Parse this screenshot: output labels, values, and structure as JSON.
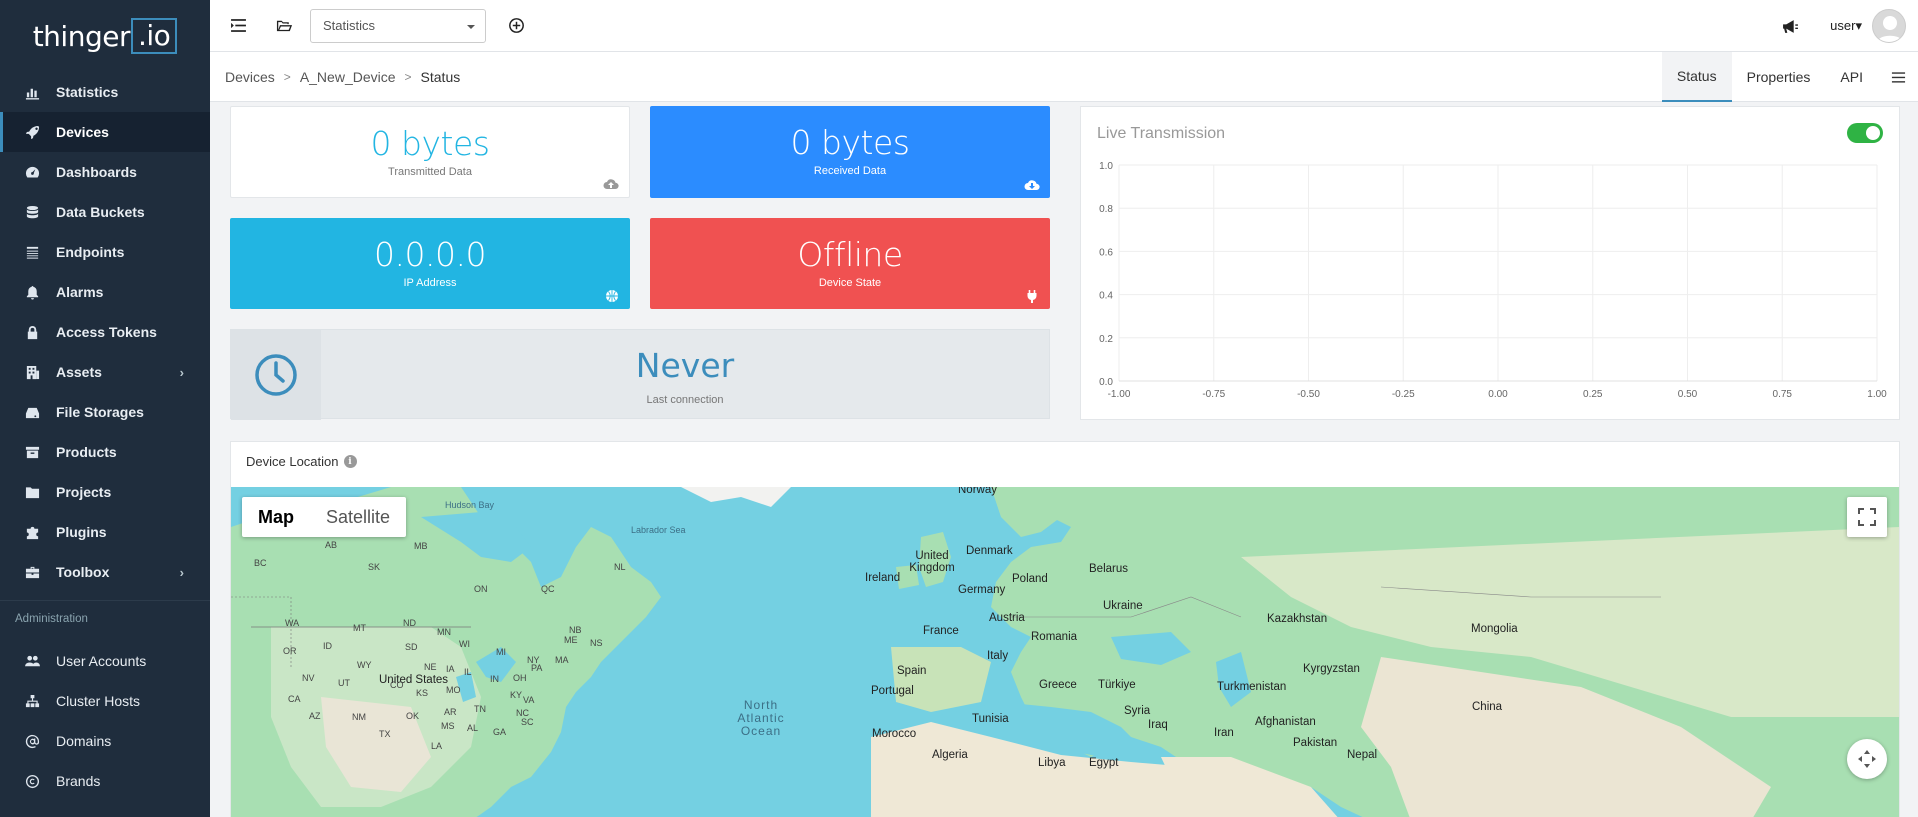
{
  "brand": {
    "name": "thinger",
    "suffix": ".io"
  },
  "sidebar": {
    "items": [
      {
        "label": "Statistics",
        "icon": "bar-chart-icon"
      },
      {
        "label": "Devices",
        "icon": "rocket-icon",
        "active": true
      },
      {
        "label": "Dashboards",
        "icon": "tachometer-icon"
      },
      {
        "label": "Data Buckets",
        "icon": "database-icon"
      },
      {
        "label": "Endpoints",
        "icon": "list-icon"
      },
      {
        "label": "Alarms",
        "icon": "bell-icon"
      },
      {
        "label": "Access Tokens",
        "icon": "lock-icon"
      },
      {
        "label": "Assets",
        "icon": "building-icon",
        "arrow": "›"
      },
      {
        "label": "File Storages",
        "icon": "hdd-icon"
      },
      {
        "label": "Products",
        "icon": "archive-icon"
      },
      {
        "label": "Projects",
        "icon": "folder-icon"
      },
      {
        "label": "Plugins",
        "icon": "puzzle-icon"
      },
      {
        "label": "Toolbox",
        "icon": "toolbox-icon",
        "arrow": "›"
      }
    ],
    "admin_header": "Administration",
    "admin_items": [
      {
        "label": "User Accounts",
        "icon": "users-icon"
      },
      {
        "label": "Cluster Hosts",
        "icon": "sitemap-icon"
      },
      {
        "label": "Domains",
        "icon": "at-icon"
      },
      {
        "label": "Brands",
        "icon": "copyright-icon"
      }
    ]
  },
  "topbar": {
    "select_value": "Statistics",
    "user_label": "user▾"
  },
  "breadcrumb": [
    "Devices",
    "A_New_Device",
    "Status"
  ],
  "tabs": [
    "Status",
    "Properties",
    "API"
  ],
  "stats": {
    "transmitted": {
      "value": "0 bytes",
      "label": "Transmitted Data"
    },
    "received": {
      "value": "0 bytes",
      "label": "Received Data"
    },
    "ip": {
      "value": "0.0.0.0",
      "label": "IP Address"
    },
    "state": {
      "value": "Offline",
      "label": "Device State"
    },
    "last_connection": {
      "value": "Never",
      "label": "Last connection"
    }
  },
  "colors": {
    "received_bg": "#2b8cff",
    "ip_bg": "#22b5e2",
    "state_bg": "#f05151",
    "transmitted_text": "#22b5e2",
    "toggle_on": "#2fb344",
    "accent": "#3c8dbc"
  },
  "live": {
    "title": "Live Transmission",
    "enabled": true
  },
  "chart_data": {
    "type": "line",
    "title": "Live Transmission",
    "x_ticks": [
      "-1.00",
      "-0.75",
      "-0.50",
      "-0.25",
      "0.00",
      "0.25",
      "0.50",
      "0.75",
      "1.00"
    ],
    "y_ticks": [
      "0.0",
      "0.2",
      "0.4",
      "0.6",
      "0.8",
      "1.0"
    ],
    "xlim": [
      -1,
      1
    ],
    "ylim": [
      0,
      1
    ],
    "series": [],
    "grid": true
  },
  "map": {
    "title": "Device Location",
    "type_buttons": [
      "Map",
      "Satellite"
    ],
    "labels": [
      {
        "text": "Norway"
      },
      {
        "text": "Hudson Bay",
        "cls": "sea"
      },
      {
        "text": "Labrador Sea",
        "cls": "sea"
      },
      {
        "text": "Denmark"
      },
      {
        "text": "United Kingdom"
      },
      {
        "text": "Ireland"
      },
      {
        "text": "Belarus"
      },
      {
        "text": "Poland"
      },
      {
        "text": "Germany"
      },
      {
        "text": "Ukraine"
      },
      {
        "text": "Kazakhstan"
      },
      {
        "text": "Mongolia"
      },
      {
        "text": "France"
      },
      {
        "text": "Austria"
      },
      {
        "text": "Romania"
      },
      {
        "text": "Italy"
      },
      {
        "text": "Spain"
      },
      {
        "text": "Portugal"
      },
      {
        "text": "Greece"
      },
      {
        "text": "Türkiye"
      },
      {
        "text": "Turkmenistan"
      },
      {
        "text": "Kyrgyzstan"
      },
      {
        "text": "China"
      },
      {
        "text": "Afghanistan"
      },
      {
        "text": "Tunisia"
      },
      {
        "text": "Syria"
      },
      {
        "text": "Iraq"
      },
      {
        "text": "Iran"
      },
      {
        "text": "Pakistan"
      },
      {
        "text": "Morocco"
      },
      {
        "text": "Algeria"
      },
      {
        "text": "Libya"
      },
      {
        "text": "Egypt"
      },
      {
        "text": "Nepal"
      },
      {
        "text": "United States"
      },
      {
        "text": "North Atlantic Ocean",
        "cls": "ocean"
      },
      {
        "text": "AB",
        "cls": "small"
      },
      {
        "text": "BC",
        "cls": "small"
      },
      {
        "text": "SK",
        "cls": "small"
      },
      {
        "text": "MB",
        "cls": "small"
      },
      {
        "text": "ON",
        "cls": "small"
      },
      {
        "text": "QC",
        "cls": "small"
      },
      {
        "text": "NL",
        "cls": "small"
      },
      {
        "text": "NB",
        "cls": "small"
      },
      {
        "text": "NS",
        "cls": "small"
      },
      {
        "text": "ME",
        "cls": "small"
      },
      {
        "text": "WA",
        "cls": "small"
      },
      {
        "text": "MT",
        "cls": "small"
      },
      {
        "text": "ND",
        "cls": "small"
      },
      {
        "text": "MN",
        "cls": "small"
      },
      {
        "text": "OR",
        "cls": "small"
      },
      {
        "text": "ID",
        "cls": "small"
      },
      {
        "text": "SD",
        "cls": "small"
      },
      {
        "text": "WI",
        "cls": "small"
      },
      {
        "text": "MI",
        "cls": "small"
      },
      {
        "text": "WY",
        "cls": "small"
      },
      {
        "text": "NE",
        "cls": "small"
      },
      {
        "text": "IA",
        "cls": "small"
      },
      {
        "text": "NY",
        "cls": "small"
      },
      {
        "text": "MA",
        "cls": "small"
      },
      {
        "text": "NV",
        "cls": "small"
      },
      {
        "text": "UT",
        "cls": "small"
      },
      {
        "text": "CO",
        "cls": "small"
      },
      {
        "text": "IL",
        "cls": "small"
      },
      {
        "text": "IN",
        "cls": "small"
      },
      {
        "text": "OH",
        "cls": "small"
      },
      {
        "text": "PA",
        "cls": "small"
      },
      {
        "text": "CA",
        "cls": "small"
      },
      {
        "text": "KS",
        "cls": "small"
      },
      {
        "text": "MO",
        "cls": "small"
      },
      {
        "text": "KY",
        "cls": "small"
      },
      {
        "text": "VA",
        "cls": "small"
      },
      {
        "text": "AZ",
        "cls": "small"
      },
      {
        "text": "NM",
        "cls": "small"
      },
      {
        "text": "OK",
        "cls": "small"
      },
      {
        "text": "AR",
        "cls": "small"
      },
      {
        "text": "TN",
        "cls": "small"
      },
      {
        "text": "NC",
        "cls": "small"
      },
      {
        "text": "TX",
        "cls": "small"
      },
      {
        "text": "MS",
        "cls": "small"
      },
      {
        "text": "AL",
        "cls": "small"
      },
      {
        "text": "GA",
        "cls": "small"
      },
      {
        "text": "SC",
        "cls": "small"
      },
      {
        "text": "LA",
        "cls": "small"
      }
    ]
  }
}
